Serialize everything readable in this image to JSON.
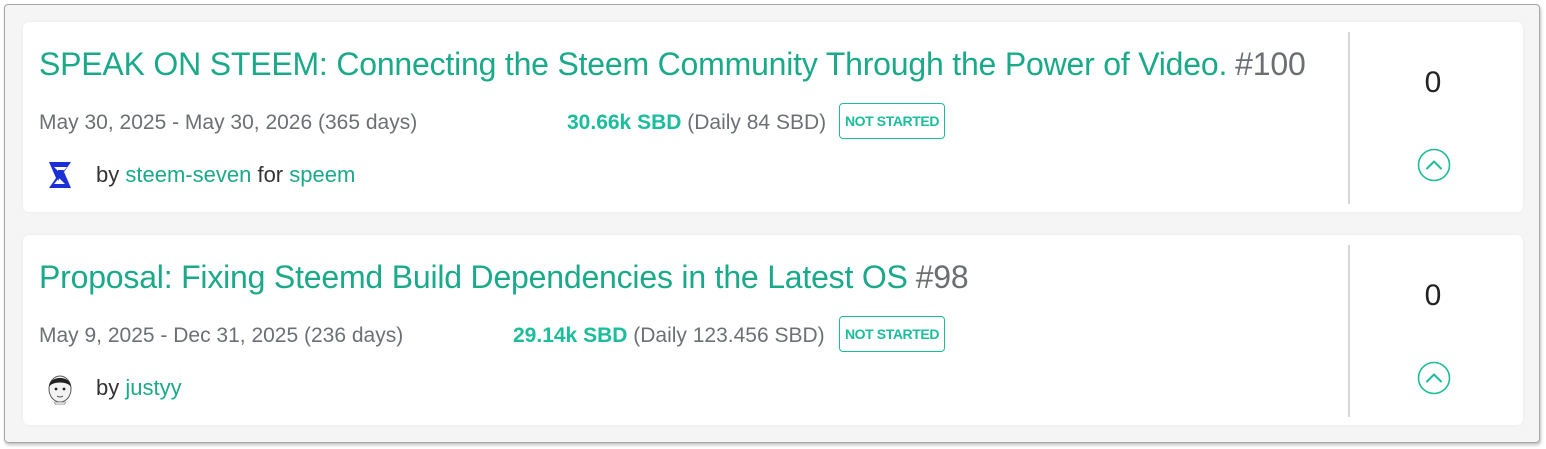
{
  "proposals": [
    {
      "title": "SPEAK ON STEEM: Connecting the Steem Community Through the Power of Video.",
      "number": "#100",
      "dates": "May 30, 2025 - May 30, 2026 (365 days)",
      "amount": "30.66k SBD",
      "daily": "(Daily 84 SBD)",
      "status": "NOT STARTED",
      "by_prefix": "by",
      "creator": "steem-seven",
      "for_prefix": "for",
      "receiver": "speem",
      "votes": "0",
      "avatar_icon": "steem-seven-logo-icon",
      "upvote_icon": "chevron-up-circle-icon"
    },
    {
      "title": "Proposal: Fixing Steemd Build Dependencies in the Latest OS",
      "number": "#98",
      "dates": "May 9, 2025 - Dec 31, 2025 (236 days)",
      "amount": "29.14k SBD",
      "daily": "(Daily 123.456 SBD)",
      "status": "NOT STARTED",
      "by_prefix": "by",
      "creator": "justyy",
      "votes": "0",
      "avatar_icon": "justyy-avatar-icon",
      "upvote_icon": "chevron-up-circle-icon"
    }
  ],
  "colors": {
    "accent": "#1aaa8a",
    "accent_bright": "#1bbd9b",
    "muted": "#6c7074",
    "divider": "#d6d6d6"
  }
}
